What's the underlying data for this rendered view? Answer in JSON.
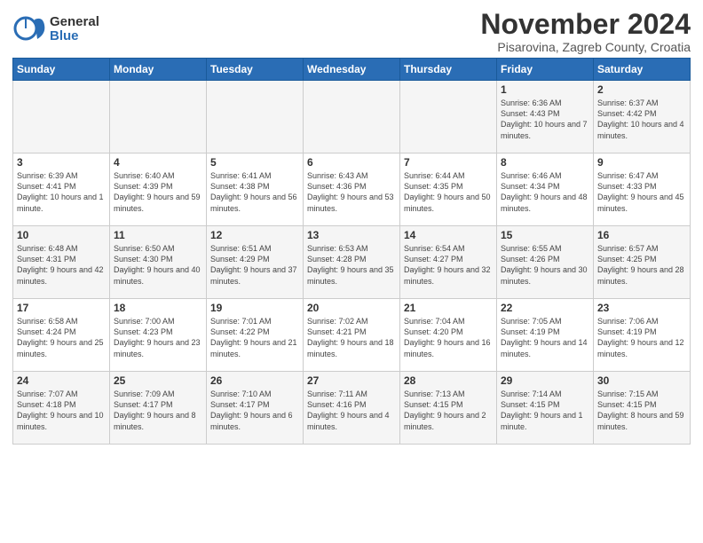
{
  "logo": {
    "general": "General",
    "blue": "Blue"
  },
  "title": "November 2024",
  "subtitle": "Pisarovina, Zagreb County, Croatia",
  "headers": [
    "Sunday",
    "Monday",
    "Tuesday",
    "Wednesday",
    "Thursday",
    "Friday",
    "Saturday"
  ],
  "weeks": [
    [
      {
        "day": "",
        "info": ""
      },
      {
        "day": "",
        "info": ""
      },
      {
        "day": "",
        "info": ""
      },
      {
        "day": "",
        "info": ""
      },
      {
        "day": "",
        "info": ""
      },
      {
        "day": "1",
        "info": "Sunrise: 6:36 AM\nSunset: 4:43 PM\nDaylight: 10 hours and 7 minutes."
      },
      {
        "day": "2",
        "info": "Sunrise: 6:37 AM\nSunset: 4:42 PM\nDaylight: 10 hours and 4 minutes."
      }
    ],
    [
      {
        "day": "3",
        "info": "Sunrise: 6:39 AM\nSunset: 4:41 PM\nDaylight: 10 hours and 1 minute."
      },
      {
        "day": "4",
        "info": "Sunrise: 6:40 AM\nSunset: 4:39 PM\nDaylight: 9 hours and 59 minutes."
      },
      {
        "day": "5",
        "info": "Sunrise: 6:41 AM\nSunset: 4:38 PM\nDaylight: 9 hours and 56 minutes."
      },
      {
        "day": "6",
        "info": "Sunrise: 6:43 AM\nSunset: 4:36 PM\nDaylight: 9 hours and 53 minutes."
      },
      {
        "day": "7",
        "info": "Sunrise: 6:44 AM\nSunset: 4:35 PM\nDaylight: 9 hours and 50 minutes."
      },
      {
        "day": "8",
        "info": "Sunrise: 6:46 AM\nSunset: 4:34 PM\nDaylight: 9 hours and 48 minutes."
      },
      {
        "day": "9",
        "info": "Sunrise: 6:47 AM\nSunset: 4:33 PM\nDaylight: 9 hours and 45 minutes."
      }
    ],
    [
      {
        "day": "10",
        "info": "Sunrise: 6:48 AM\nSunset: 4:31 PM\nDaylight: 9 hours and 42 minutes."
      },
      {
        "day": "11",
        "info": "Sunrise: 6:50 AM\nSunset: 4:30 PM\nDaylight: 9 hours and 40 minutes."
      },
      {
        "day": "12",
        "info": "Sunrise: 6:51 AM\nSunset: 4:29 PM\nDaylight: 9 hours and 37 minutes."
      },
      {
        "day": "13",
        "info": "Sunrise: 6:53 AM\nSunset: 4:28 PM\nDaylight: 9 hours and 35 minutes."
      },
      {
        "day": "14",
        "info": "Sunrise: 6:54 AM\nSunset: 4:27 PM\nDaylight: 9 hours and 32 minutes."
      },
      {
        "day": "15",
        "info": "Sunrise: 6:55 AM\nSunset: 4:26 PM\nDaylight: 9 hours and 30 minutes."
      },
      {
        "day": "16",
        "info": "Sunrise: 6:57 AM\nSunset: 4:25 PM\nDaylight: 9 hours and 28 minutes."
      }
    ],
    [
      {
        "day": "17",
        "info": "Sunrise: 6:58 AM\nSunset: 4:24 PM\nDaylight: 9 hours and 25 minutes."
      },
      {
        "day": "18",
        "info": "Sunrise: 7:00 AM\nSunset: 4:23 PM\nDaylight: 9 hours and 23 minutes."
      },
      {
        "day": "19",
        "info": "Sunrise: 7:01 AM\nSunset: 4:22 PM\nDaylight: 9 hours and 21 minutes."
      },
      {
        "day": "20",
        "info": "Sunrise: 7:02 AM\nSunset: 4:21 PM\nDaylight: 9 hours and 18 minutes."
      },
      {
        "day": "21",
        "info": "Sunrise: 7:04 AM\nSunset: 4:20 PM\nDaylight: 9 hours and 16 minutes."
      },
      {
        "day": "22",
        "info": "Sunrise: 7:05 AM\nSunset: 4:19 PM\nDaylight: 9 hours and 14 minutes."
      },
      {
        "day": "23",
        "info": "Sunrise: 7:06 AM\nSunset: 4:19 PM\nDaylight: 9 hours and 12 minutes."
      }
    ],
    [
      {
        "day": "24",
        "info": "Sunrise: 7:07 AM\nSunset: 4:18 PM\nDaylight: 9 hours and 10 minutes."
      },
      {
        "day": "25",
        "info": "Sunrise: 7:09 AM\nSunset: 4:17 PM\nDaylight: 9 hours and 8 minutes."
      },
      {
        "day": "26",
        "info": "Sunrise: 7:10 AM\nSunset: 4:17 PM\nDaylight: 9 hours and 6 minutes."
      },
      {
        "day": "27",
        "info": "Sunrise: 7:11 AM\nSunset: 4:16 PM\nDaylight: 9 hours and 4 minutes."
      },
      {
        "day": "28",
        "info": "Sunrise: 7:13 AM\nSunset: 4:15 PM\nDaylight: 9 hours and 2 minutes."
      },
      {
        "day": "29",
        "info": "Sunrise: 7:14 AM\nSunset: 4:15 PM\nDaylight: 9 hours and 1 minute."
      },
      {
        "day": "30",
        "info": "Sunrise: 7:15 AM\nSunset: 4:15 PM\nDaylight: 8 hours and 59 minutes."
      }
    ]
  ]
}
